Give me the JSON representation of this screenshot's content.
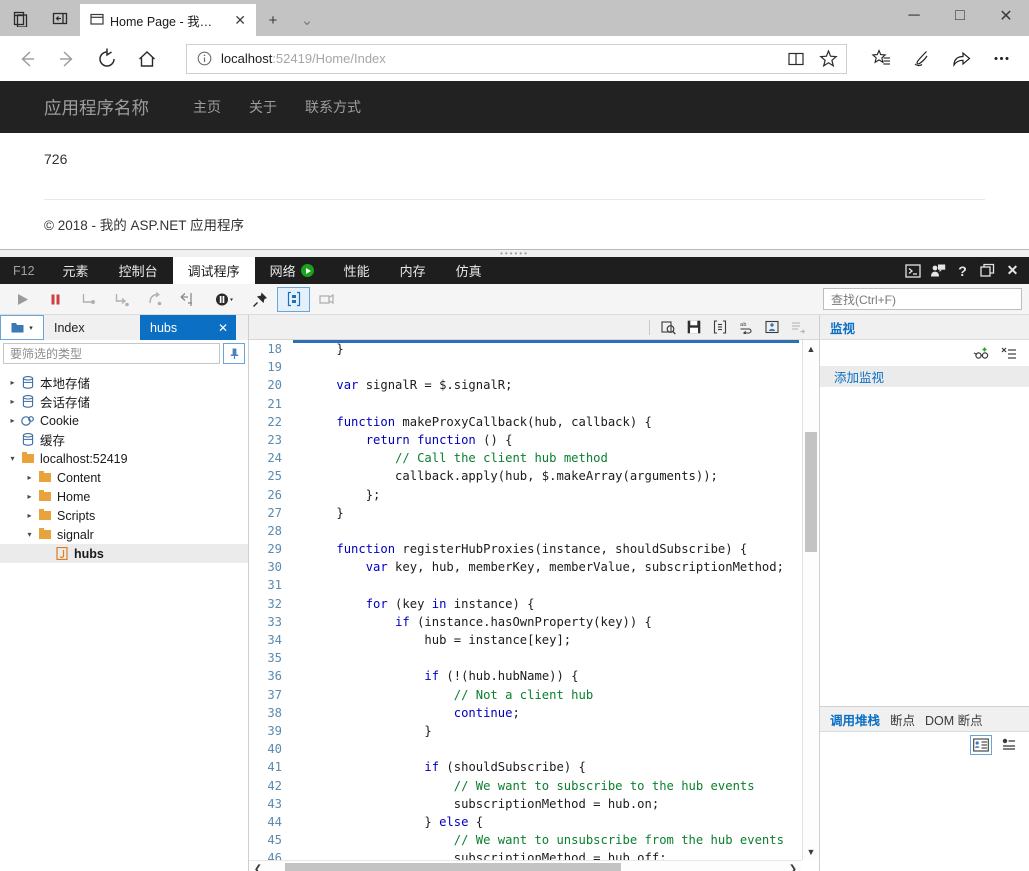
{
  "browser": {
    "tab": {
      "title": "Home Page - 我的 ASP.",
      "close": "✕"
    },
    "newtab_label": "+",
    "tablist_label": "⌄",
    "window": {
      "minimize": "─",
      "maximize": "□",
      "close": "✕"
    },
    "address": {
      "host": "localhost",
      "path": ":52419/Home/Index",
      "full": "localhost:52419/Home/Index"
    }
  },
  "site": {
    "brand": "应用程序名称",
    "links": [
      "主页",
      "关于",
      "联系方式"
    ],
    "counter": "726",
    "footer": "© 2018 - 我的 ASP.NET 应用程序"
  },
  "devtools": {
    "f12_label": "F12",
    "tabs": [
      {
        "label": "元素",
        "active": false,
        "icon": ""
      },
      {
        "label": "控制台",
        "active": false,
        "icon": ""
      },
      {
        "label": "调试程序",
        "active": true,
        "icon": ""
      },
      {
        "label": "网络",
        "active": false,
        "icon": "record-icon"
      },
      {
        "label": "性能",
        "active": false,
        "icon": ""
      },
      {
        "label": "内存",
        "active": false,
        "icon": ""
      },
      {
        "label": "仿真",
        "active": false,
        "icon": ""
      }
    ],
    "find_placeholder": "查找(Ctrl+F)",
    "filter_placeholder": "要筛选的类型",
    "file_tabs": [
      {
        "label": "Index",
        "active": false
      },
      {
        "label": "hubs",
        "active": true,
        "close": "✕"
      }
    ],
    "tree": [
      {
        "label": "本地存储",
        "depth": 0,
        "twisty": "▸",
        "icon": "database-icon"
      },
      {
        "label": "会话存储",
        "depth": 0,
        "twisty": "▸",
        "icon": "database-icon"
      },
      {
        "label": "Cookie",
        "depth": 0,
        "twisty": "▸",
        "icon": "cookie-icon"
      },
      {
        "label": "缓存",
        "depth": 0,
        "twisty": "",
        "icon": "database-icon"
      },
      {
        "label": "localhost:52419",
        "depth": 0,
        "twisty": "▾",
        "icon": "folder-icon"
      },
      {
        "label": "Content",
        "depth": 1,
        "twisty": "▸",
        "icon": "folder-icon"
      },
      {
        "label": "Home",
        "depth": 1,
        "twisty": "▸",
        "icon": "folder-icon"
      },
      {
        "label": "Scripts",
        "depth": 1,
        "twisty": "▸",
        "icon": "folder-icon"
      },
      {
        "label": "signalr",
        "depth": 1,
        "twisty": "▾",
        "icon": "folder-icon"
      },
      {
        "label": "hubs",
        "depth": 2,
        "twisty": "",
        "icon": "js-file-icon",
        "selected": true
      }
    ],
    "watch": {
      "tab": "监视",
      "add_label": "添加监视"
    },
    "callstack": {
      "tabs": [
        {
          "label": "调用堆栈",
          "active": true
        },
        {
          "label": "断点",
          "active": false
        },
        {
          "label": "DOM 断点",
          "active": false
        }
      ]
    },
    "code": {
      "lines": [
        {
          "n": 18,
          "segs": [
            {
              "t": "    }"
            }
          ]
        },
        {
          "n": 19,
          "segs": [
            {
              "t": ""
            }
          ]
        },
        {
          "n": 20,
          "segs": [
            {
              "t": "    "
            },
            {
              "t": "var",
              "c": "kw"
            },
            {
              "t": " signalR = $.signalR;"
            }
          ]
        },
        {
          "n": 21,
          "segs": [
            {
              "t": ""
            }
          ]
        },
        {
          "n": 22,
          "segs": [
            {
              "t": "    "
            },
            {
              "t": "function",
              "c": "kw"
            },
            {
              "t": " makeProxyCallback(hub, callback) {"
            }
          ]
        },
        {
          "n": 23,
          "segs": [
            {
              "t": "        "
            },
            {
              "t": "return function",
              "c": "kw"
            },
            {
              "t": " () {"
            }
          ]
        },
        {
          "n": 24,
          "segs": [
            {
              "t": "            "
            },
            {
              "t": "// Call the client hub method",
              "c": "cm"
            }
          ]
        },
        {
          "n": 25,
          "segs": [
            {
              "t": "            callback.apply(hub, $.makeArray(arguments));"
            }
          ]
        },
        {
          "n": 26,
          "segs": [
            {
              "t": "        };"
            }
          ]
        },
        {
          "n": 27,
          "segs": [
            {
              "t": "    }"
            }
          ]
        },
        {
          "n": 28,
          "segs": [
            {
              "t": ""
            }
          ]
        },
        {
          "n": 29,
          "segs": [
            {
              "t": "    "
            },
            {
              "t": "function",
              "c": "kw"
            },
            {
              "t": " registerHubProxies(instance, shouldSubscribe) {"
            }
          ]
        },
        {
          "n": 30,
          "segs": [
            {
              "t": "        "
            },
            {
              "t": "var",
              "c": "kw"
            },
            {
              "t": " key, hub, memberKey, memberValue, subscriptionMethod;"
            }
          ]
        },
        {
          "n": 31,
          "segs": [
            {
              "t": ""
            }
          ]
        },
        {
          "n": 32,
          "segs": [
            {
              "t": "        "
            },
            {
              "t": "for",
              "c": "kw"
            },
            {
              "t": " (key "
            },
            {
              "t": "in",
              "c": "kw"
            },
            {
              "t": " instance) {"
            }
          ]
        },
        {
          "n": 33,
          "segs": [
            {
              "t": "            "
            },
            {
              "t": "if",
              "c": "kw"
            },
            {
              "t": " (instance.hasOwnProperty(key)) {"
            }
          ]
        },
        {
          "n": 34,
          "segs": [
            {
              "t": "                hub = instance[key];"
            }
          ]
        },
        {
          "n": 35,
          "segs": [
            {
              "t": ""
            }
          ]
        },
        {
          "n": 36,
          "segs": [
            {
              "t": "                "
            },
            {
              "t": "if",
              "c": "kw"
            },
            {
              "t": " (!(hub.hubName)) {"
            }
          ]
        },
        {
          "n": 37,
          "segs": [
            {
              "t": "                    "
            },
            {
              "t": "// Not a client hub",
              "c": "cm"
            }
          ]
        },
        {
          "n": 38,
          "segs": [
            {
              "t": "                    "
            },
            {
              "t": "continue",
              "c": "kw"
            },
            {
              "t": ";"
            }
          ]
        },
        {
          "n": 39,
          "segs": [
            {
              "t": "                }"
            }
          ]
        },
        {
          "n": 40,
          "segs": [
            {
              "t": ""
            }
          ]
        },
        {
          "n": 41,
          "segs": [
            {
              "t": "                "
            },
            {
              "t": "if",
              "c": "kw"
            },
            {
              "t": " (shouldSubscribe) {"
            }
          ]
        },
        {
          "n": 42,
          "segs": [
            {
              "t": "                    "
            },
            {
              "t": "// We want to subscribe to the hub events",
              "c": "cm"
            }
          ]
        },
        {
          "n": 43,
          "segs": [
            {
              "t": "                    subscriptionMethod = hub.on;"
            }
          ]
        },
        {
          "n": 44,
          "segs": [
            {
              "t": "                } "
            },
            {
              "t": "else",
              "c": "kw"
            },
            {
              "t": " {"
            }
          ]
        },
        {
          "n": 45,
          "segs": [
            {
              "t": "                    "
            },
            {
              "t": "// We want to unsubscribe from the hub events",
              "c": "cm"
            }
          ]
        },
        {
          "n": 46,
          "segs": [
            {
              "t": "                    subscriptionMethod = hub.off;"
            }
          ]
        }
      ]
    }
  }
}
